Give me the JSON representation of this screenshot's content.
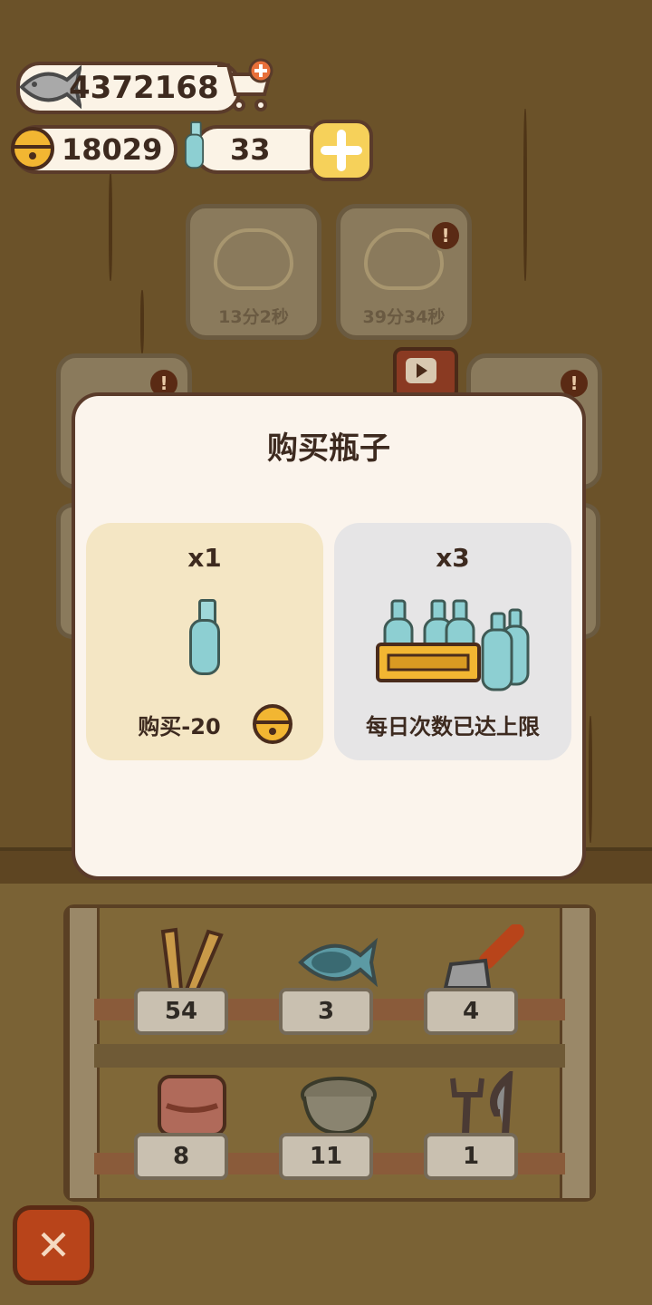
{
  "currency": {
    "fish": "4372168",
    "bells": "18029",
    "bottles": "33"
  },
  "background_tiles": [
    {
      "timer": "13分2秒"
    },
    {
      "timer": "39分34秒"
    }
  ],
  "modal": {
    "title": "购买瓶子",
    "option_single": {
      "qty": "x1",
      "label": "购买-20"
    },
    "option_triple": {
      "qty": "x3",
      "label": "每日次数已达上限"
    }
  },
  "shelf": {
    "items": [
      {
        "icon": "brush-icon",
        "count": "54"
      },
      {
        "icon": "fish-toy-icon",
        "count": "3"
      },
      {
        "icon": "scoop-icon",
        "count": "4"
      },
      {
        "icon": "towel-icon",
        "count": "8"
      },
      {
        "icon": "bowl-icon",
        "count": "11"
      },
      {
        "icon": "utensils-icon",
        "count": "1"
      }
    ]
  },
  "colors": {
    "modal_bg": "#fbf4ec",
    "option_available": "#f4e6c4",
    "option_disabled": "#e6e5e6",
    "close_button": "#b8441a"
  }
}
